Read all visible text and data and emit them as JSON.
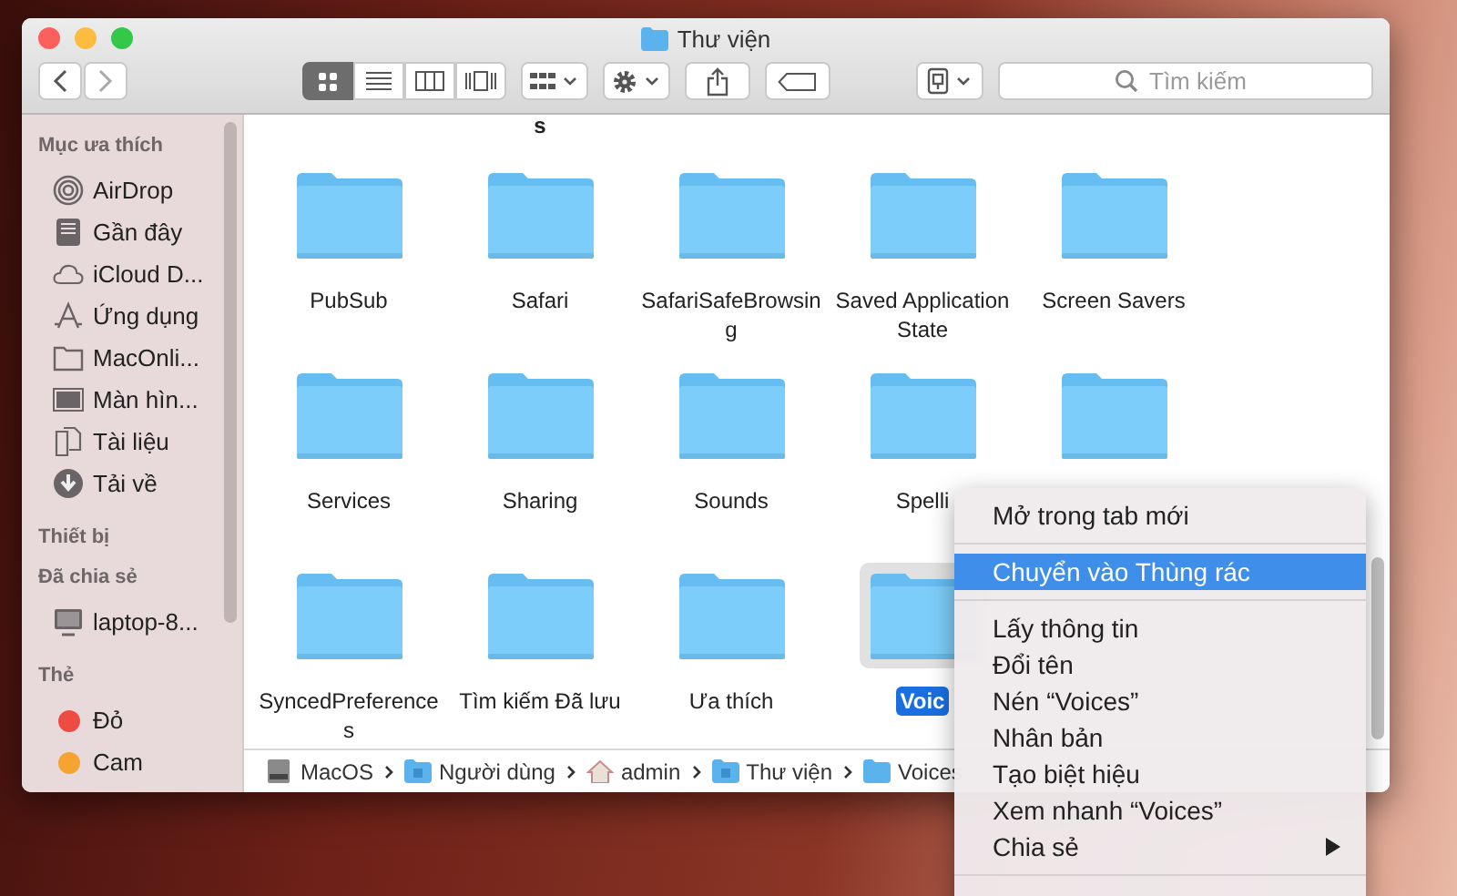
{
  "window": {
    "title": "Thư viện"
  },
  "toolbar": {
    "view_modes": [
      {
        "selected": true
      },
      {
        "selected": false
      },
      {
        "selected": false
      },
      {
        "selected": false
      }
    ],
    "search": {
      "placeholder": "Tìm kiếm"
    }
  },
  "sidebar": {
    "sections": [
      {
        "title": "Mục ưa thích",
        "items": [
          {
            "kind": "place",
            "label": "AirDrop"
          },
          {
            "kind": "place",
            "label": "Gần đây"
          },
          {
            "kind": "place",
            "label": "iCloud D..."
          },
          {
            "kind": "place",
            "label": "Ứng dụng"
          },
          {
            "kind": "place",
            "label": "MacOnli..."
          },
          {
            "kind": "place",
            "label": "Màn hìn..."
          },
          {
            "kind": "place",
            "label": "Tài liệu"
          },
          {
            "kind": "place",
            "label": "Tải về"
          }
        ]
      },
      {
        "title": "Thiết bị"
      },
      {
        "title": "Đã chia sẻ",
        "items": [
          {
            "kind": "place",
            "label": "laptop-8..."
          }
        ]
      },
      {
        "title": "Thẻ",
        "items": [
          {
            "kind": "tag",
            "label": "Đỏ",
            "color": "#ee4b43"
          },
          {
            "kind": "tag",
            "label": "Cam",
            "color": "#f5a431"
          }
        ]
      }
    ]
  },
  "cut_label": "s",
  "folders": [
    {
      "label": "PubSub",
      "selected": false
    },
    {
      "label": "Safari",
      "selected": false
    },
    {
      "label": "SafariSafeBrowsing",
      "selected": false
    },
    {
      "label": "Saved Application State",
      "selected": false
    },
    {
      "label": "Screen Savers",
      "selected": false
    },
    {
      "label": "Services",
      "selected": false
    },
    {
      "label": "Sharing",
      "selected": false
    },
    {
      "label": "Sounds",
      "selected": false
    },
    {
      "label": "Spelli",
      "selected": false
    },
    {
      "selected": false
    },
    {
      "label": "SyncedPreferences",
      "selected": false
    },
    {
      "label": "Tìm kiếm Đã lưu",
      "selected": false
    },
    {
      "label": "Ưa thích",
      "selected": false
    },
    {
      "label": "Voic",
      "selected": true
    }
  ],
  "path_bar": [
    {
      "label": "MacOS"
    },
    {
      "label": "Người dùng"
    },
    {
      "label": "admin"
    },
    {
      "label": "Thư viện"
    },
    {
      "label": "Voices"
    }
  ],
  "context_menu": [
    {
      "kind": "item",
      "label": "Mở trong tab mới",
      "selected": false,
      "has_submenu": false
    },
    {
      "kind": "separator"
    },
    {
      "kind": "item",
      "label": "Chuyển vào Thùng rác",
      "selected": true,
      "has_submenu": false
    },
    {
      "kind": "separator"
    },
    {
      "kind": "item",
      "label": "Lấy thông tin",
      "selected": false,
      "has_submenu": false
    },
    {
      "kind": "item",
      "label": "Đổi tên",
      "selected": false,
      "has_submenu": false
    },
    {
      "kind": "item",
      "label": "Nén “Voices”",
      "selected": false,
      "has_submenu": false
    },
    {
      "kind": "item",
      "label": "Nhân bản",
      "selected": false,
      "has_submenu": false
    },
    {
      "kind": "item",
      "label": "Tạo biệt hiệu",
      "selected": false,
      "has_submenu": false
    },
    {
      "kind": "item",
      "label": "Xem nhanh “Voices”",
      "selected": false,
      "has_submenu": false
    },
    {
      "kind": "item",
      "label": "Chia sẻ",
      "selected": false,
      "has_submenu": true
    },
    {
      "kind": "separator"
    }
  ]
}
